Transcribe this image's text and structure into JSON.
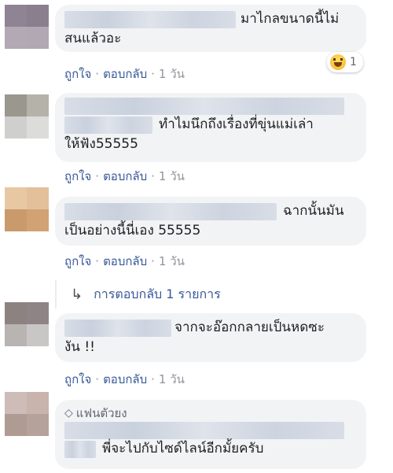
{
  "comments": [
    {
      "line1_text": "มาไกลขนาดนี้ไม่",
      "line2_text": "สนแล้วอะ",
      "like": "ถูกใจ",
      "reply": "ตอบกลับ",
      "time": "1 วัน",
      "reaction_count": "1"
    },
    {
      "line2_text": "ทำไมนึกถึงเรื่องที่ขุ่นแม่เล่า",
      "line3_text": "ให้ฟัง55555",
      "like": "ถูกใจ",
      "reply": "ตอบกลับ",
      "time": "1 วัน"
    },
    {
      "line1_text": "ฉากนั้นมัน",
      "line2_text": "เป็นอย่างนี้นี่เอง 55555",
      "like": "ถูกใจ",
      "reply": "ตอบกลับ",
      "time": "1 วัน"
    },
    {
      "line1_text": "จากจะอ๊อกกลายเป็นหดซะ",
      "line2_text": "งัน !!",
      "like": "ถูกใจ",
      "reply": "ตอบกลับ",
      "time": "1 วัน"
    },
    {
      "badge": "แฟนตัวยง",
      "line2_text": "พี่จะไปกับไซด์ไลน์อีกมั้ยครับ"
    }
  ],
  "replies_link": "การตอบกลับ 1 รายการ",
  "colors": {
    "link": "#385898",
    "bubble": "#f2f3f5",
    "meta": "#90949c"
  }
}
